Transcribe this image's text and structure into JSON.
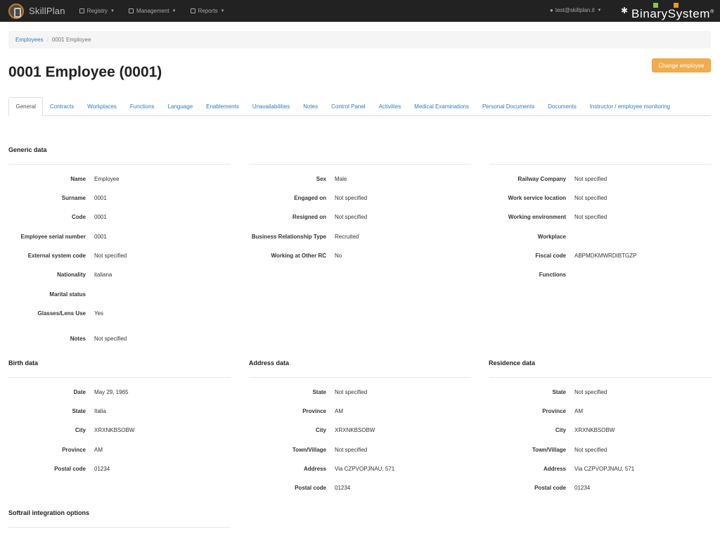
{
  "navbar": {
    "brand": "SkillPlan",
    "menu": [
      {
        "label": "Registry"
      },
      {
        "label": "Management"
      },
      {
        "label": "Reports"
      }
    ],
    "user": "test@skillplan.it",
    "company_logo": "BinarySystem",
    "logo_colors": [
      "#8bc34a",
      "#f7941d"
    ]
  },
  "breadcrumb": {
    "link": "Employees",
    "separator": "/",
    "current": "0001 Employee"
  },
  "page": {
    "title": "0001 Employee (0001)",
    "change_button": "Change employee"
  },
  "tabs": [
    "General",
    "Contracts",
    "Workplaces",
    "Functions",
    "Language",
    "Enablements",
    "Unavailabilities",
    "Notes",
    "Control Panel",
    "Activities",
    "Medical Examinations",
    "Personal Documents",
    "Documents",
    "Instructor / employee monitoring"
  ],
  "generic": {
    "title": "Generic data",
    "col1": [
      {
        "label": "Name",
        "value": "Employee"
      },
      {
        "label": "Surname",
        "value": "0001"
      },
      {
        "label": "Code",
        "value": "0001"
      },
      {
        "label": "Employee serial number",
        "value": "0001"
      },
      {
        "label": "External system code",
        "value": "Not specified"
      },
      {
        "label": "Nationality",
        "value": "italiana"
      },
      {
        "label": "Marital status",
        "value": ""
      },
      {
        "label": "Glasses/Lens Use",
        "value": "Yes"
      },
      {
        "label": "Notes",
        "value": "Not specified"
      }
    ],
    "col2": [
      {
        "label": "Sex",
        "value": "Male"
      },
      {
        "label": "Engaged on",
        "value": "Not specified"
      },
      {
        "label": "Resigned on",
        "value": "Not specified"
      },
      {
        "label": "Business Relationship Type",
        "value": "Recruited"
      },
      {
        "label": "Working at Other RC",
        "value": "No"
      }
    ],
    "col3": [
      {
        "label": "Railway Company",
        "value": "Not specified"
      },
      {
        "label": "Work service location",
        "value": "Not specified"
      },
      {
        "label": "Working environment",
        "value": "Not specified"
      },
      {
        "label": "Workplace",
        "value": ""
      },
      {
        "label": "Fiscal code",
        "value": "ABPMDKMWRDIBTGZP"
      },
      {
        "label": "Functions",
        "value": ""
      }
    ]
  },
  "birth": {
    "title": "Birth data",
    "rows": [
      {
        "label": "Date",
        "value": "May 29, 1965"
      },
      {
        "label": "State",
        "value": "Italia"
      },
      {
        "label": "City",
        "value": "XRXNKBSOBW"
      },
      {
        "label": "Province",
        "value": "AM"
      },
      {
        "label": "Postal code",
        "value": "01234"
      }
    ]
  },
  "address": {
    "title": "Address data",
    "rows": [
      {
        "label": "State",
        "value": "Not specified"
      },
      {
        "label": "Province",
        "value": "AM"
      },
      {
        "label": "City",
        "value": "XRXNKBSOBW"
      },
      {
        "label": "Town/Village",
        "value": "Not specified"
      },
      {
        "label": "Address",
        "value": "Via CZPVOPJNAU, 571"
      },
      {
        "label": "Postal code",
        "value": "01234"
      }
    ]
  },
  "residence": {
    "title": "Residence data",
    "rows": [
      {
        "label": "State",
        "value": "Not specified"
      },
      {
        "label": "Province",
        "value": "AM"
      },
      {
        "label": "City",
        "value": "XRXNKBSOBW"
      },
      {
        "label": "Town/Village",
        "value": "Not specified"
      },
      {
        "label": "Address",
        "value": "Via CZPVOPJNAU, 571"
      },
      {
        "label": "Postal code",
        "value": "01234"
      }
    ]
  },
  "softrail": {
    "title": "Softrail integration options"
  }
}
